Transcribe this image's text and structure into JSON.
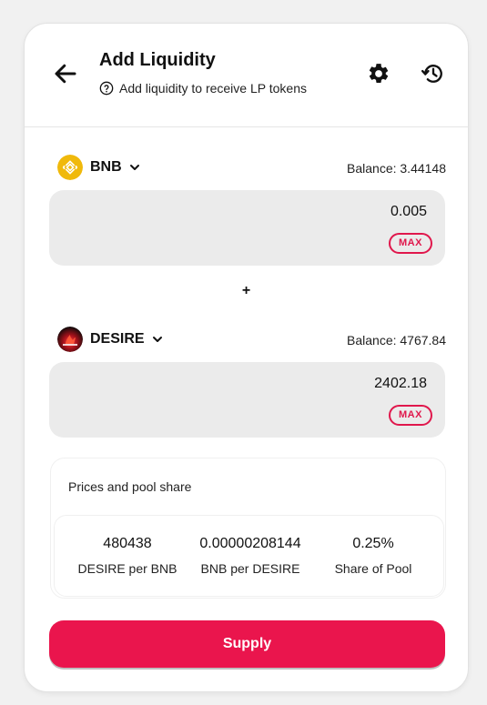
{
  "header": {
    "title": "Add Liquidity",
    "subtitle": "Add liquidity to receive LP tokens"
  },
  "token_a": {
    "symbol": "BNB",
    "balance": "Balance: 3.44148",
    "amount": "0.005",
    "max_label": "MAX"
  },
  "plus_sign": "+",
  "token_b": {
    "symbol": "DESIRE",
    "balance": "Balance: 4767.84",
    "amount": "2402.18",
    "max_label": "MAX"
  },
  "prices": {
    "title": "Prices and pool share",
    "stats": [
      {
        "value": "480438",
        "label": "DESIRE per BNB"
      },
      {
        "value": "0.00000208144",
        "label": "BNB per DESIRE"
      },
      {
        "value": "0.25%",
        "label": "Share of Pool"
      }
    ]
  },
  "supply_label": "Supply",
  "colors": {
    "accent": "#ea154d",
    "input_bg": "#ebebeb",
    "bnb_yellow": "#f0b90b"
  },
  "icons": [
    "arrow-left-icon",
    "help-circle-icon",
    "gear-icon",
    "history-icon",
    "chevron-down-icon",
    "bnb-logo-icon",
    "desire-logo-icon"
  ]
}
